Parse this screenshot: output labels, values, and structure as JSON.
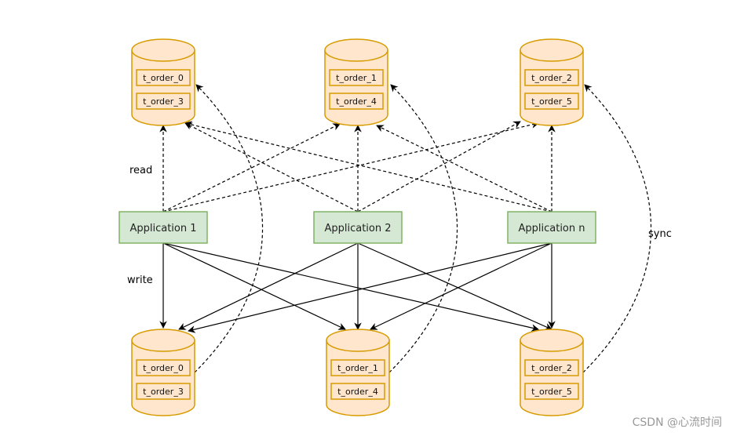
{
  "colors": {
    "db_fill": "#ffe6cc",
    "db_stroke": "#d79b00",
    "app_fill": "#d5e8d4",
    "app_stroke": "#82b366",
    "line": "#000000"
  },
  "top_dbs": [
    {
      "tables": [
        "t_order_0",
        "t_order_3"
      ]
    },
    {
      "tables": [
        "t_order_1",
        "t_order_4"
      ]
    },
    {
      "tables": [
        "t_order_2",
        "t_order_5"
      ]
    }
  ],
  "bottom_dbs": [
    {
      "tables": [
        "t_order_0",
        "t_order_3"
      ]
    },
    {
      "tables": [
        "t_order_1",
        "t_order_4"
      ]
    },
    {
      "tables": [
        "t_order_2",
        "t_order_5"
      ]
    }
  ],
  "apps": [
    "Application 1",
    "Application 2",
    "Application n"
  ],
  "labels": {
    "read": "read",
    "write": "write",
    "sync": "sync"
  },
  "watermark": "CSDN @心流时间"
}
